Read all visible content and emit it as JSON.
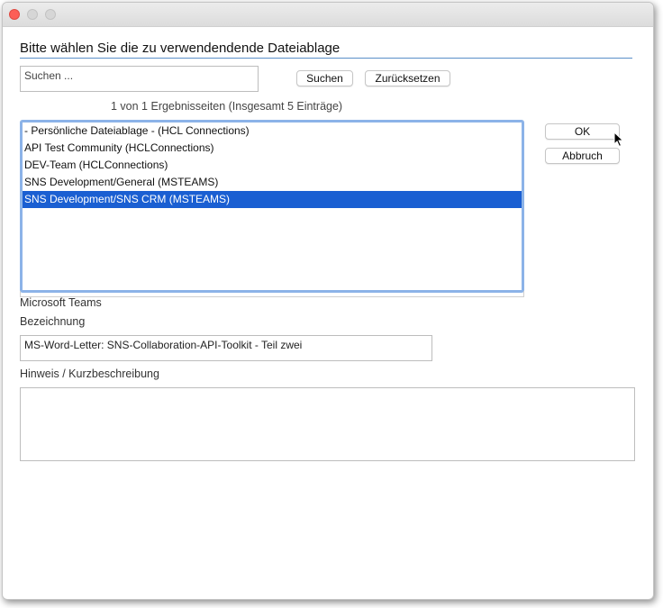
{
  "dialog": {
    "heading": "Bitte wählen Sie die zu verwendendende Dateiablage"
  },
  "search": {
    "placeholder": "Suchen ...",
    "search_button": "Suchen",
    "reset_button": "Zurücksetzen"
  },
  "pager": {
    "text": "1 von 1 Ergebnisseiten (Insgesamt 5 Einträge)"
  },
  "list": {
    "items": [
      {
        "label": "- Persönliche Dateiablage - (HCL Connections)"
      },
      {
        "label": "API Test Community (HCLConnections)"
      },
      {
        "label": "DEV-Team (HCLConnections)"
      },
      {
        "label": "SNS Development/General (MSTEAMS)"
      },
      {
        "label": "SNS Development/SNS CRM (MSTEAMS)",
        "selected": true
      }
    ],
    "selection_color": "#1a5fd2"
  },
  "actions": {
    "ok": "OK",
    "cancel": "Abbruch"
  },
  "details": {
    "source": "Microsoft Teams",
    "name_label": "Bezeichnung",
    "name_value": "MS-Word-Letter: SNS-Collaboration-API-Toolkit - Teil zwei",
    "note_label": "Hinweis / Kurzbeschreibung",
    "note_value": ""
  },
  "icons": {
    "close": "close-traffic-light-icon",
    "minimize": "minimize-traffic-light-icon",
    "maximize": "maximize-traffic-light-icon",
    "cursor": "mouse-pointer-icon"
  }
}
